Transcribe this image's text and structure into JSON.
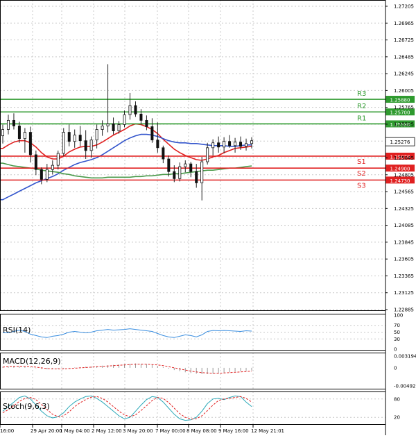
{
  "chart_data": {
    "type": "candlestick",
    "instrument_note": "",
    "x_tick_labels": [
      "16:00",
      "29 Apr 20:00",
      "1 May 04:00",
      "2 May 12:00",
      "3 May 20:00",
      "7 May 00:00",
      "8 May 08:00",
      "9 May 16:00",
      "12 May 21:01"
    ],
    "price_axis": {
      "ylim": [
        1.22885,
        1.27205
      ],
      "tick_labels": [
        "1.27205",
        "1.26965",
        "1.26725",
        "1.26485",
        "1.26245",
        "1.26005",
        "1.25765",
        "1.25525",
        "1.25285",
        "1.25045",
        "1.24805",
        "1.24565",
        "1.24325",
        "1.24085",
        "1.23845",
        "1.23605",
        "1.23365",
        "1.23125",
        "1.22885"
      ]
    },
    "levels": [
      {
        "name": "R3",
        "value": 1.2588,
        "label": "1.25880",
        "color": "#2e9a2e"
      },
      {
        "name": "R2",
        "value": 1.257,
        "label": "1.25700",
        "color": "#2e9a2e"
      },
      {
        "name": "R1",
        "value": 1.2553,
        "label": "1.25530",
        "color": "#2e9a2e"
      },
      {
        "name": "S1",
        "value": 1.2507,
        "label": "1.25070",
        "color": "#e02020"
      },
      {
        "name": "S2",
        "value": 1.249,
        "label": "1.24900",
        "color": "#e02020"
      },
      {
        "name": "S3",
        "value": 1.2473,
        "label": "1.24730",
        "color": "#e02020"
      }
    ],
    "last_price": {
      "value": 1.25276,
      "label": "1.25276"
    },
    "candles_ohlc": [
      [
        1.2536,
        1.2552,
        1.2525,
        1.2545
      ],
      [
        1.2545,
        1.2566,
        1.2538,
        1.2558
      ],
      [
        1.2558,
        1.2568,
        1.2545,
        1.255
      ],
      [
        1.255,
        1.2556,
        1.2526,
        1.2532
      ],
      [
        1.2532,
        1.2547,
        1.2512,
        1.2541
      ],
      [
        1.2541,
        1.2549,
        1.2498,
        1.2509
      ],
      [
        1.2509,
        1.2515,
        1.248,
        1.2488
      ],
      [
        1.2488,
        1.2491,
        1.2467,
        1.2474
      ],
      [
        1.2474,
        1.2496,
        1.247,
        1.2488
      ],
      [
        1.2488,
        1.2501,
        1.2481,
        1.2494
      ],
      [
        1.2494,
        1.2515,
        1.2488,
        1.2511
      ],
      [
        1.2511,
        1.2547,
        1.2507,
        1.2541
      ],
      [
        1.2541,
        1.2552,
        1.2521,
        1.2528
      ],
      [
        1.2528,
        1.2545,
        1.2519,
        1.2537
      ],
      [
        1.2537,
        1.255,
        1.2521,
        1.2529
      ],
      [
        1.2529,
        1.2544,
        1.2503,
        1.2515
      ],
      [
        1.2515,
        1.2535,
        1.2505,
        1.253
      ],
      [
        1.253,
        1.2552,
        1.2518,
        1.2545
      ],
      [
        1.2545,
        1.2558,
        1.2536,
        1.255
      ],
      [
        1.255,
        1.2638,
        1.2541,
        1.2553
      ],
      [
        1.2553,
        1.2562,
        1.2538,
        1.2543
      ],
      [
        1.2543,
        1.2557,
        1.2539,
        1.2552
      ],
      [
        1.2552,
        1.2572,
        1.2548,
        1.2566
      ],
      [
        1.2566,
        1.2597,
        1.2559,
        1.2579
      ],
      [
        1.2579,
        1.2585,
        1.2563,
        1.2567
      ],
      [
        1.2567,
        1.2574,
        1.2552,
        1.2558
      ],
      [
        1.2558,
        1.2565,
        1.2544,
        1.2549
      ],
      [
        1.2549,
        1.2561,
        1.2526,
        1.253
      ],
      [
        1.253,
        1.2555,
        1.2512,
        1.2519
      ],
      [
        1.2519,
        1.2522,
        1.2497,
        1.2503
      ],
      [
        1.2503,
        1.2508,
        1.2478,
        1.2485
      ],
      [
        1.2485,
        1.2494,
        1.247,
        1.2475
      ],
      [
        1.2475,
        1.2498,
        1.2471,
        1.2492
      ],
      [
        1.2492,
        1.2501,
        1.2484,
        1.2496
      ],
      [
        1.2496,
        1.2499,
        1.2477,
        1.2485
      ],
      [
        1.2485,
        1.2496,
        1.2462,
        1.2469
      ],
      [
        1.2469,
        1.2506,
        1.2444,
        1.2499
      ],
      [
        1.2499,
        1.2526,
        1.2495,
        1.2519
      ],
      [
        1.2519,
        1.2531,
        1.2508,
        1.2526
      ],
      [
        1.2526,
        1.2535,
        1.2512,
        1.252
      ],
      [
        1.252,
        1.2534,
        1.2511,
        1.2528
      ],
      [
        1.2528,
        1.2537,
        1.2519,
        1.2522
      ],
      [
        1.2522,
        1.2533,
        1.2512,
        1.2527
      ],
      [
        1.2527,
        1.2535,
        1.2516,
        1.2521
      ],
      [
        1.2521,
        1.2532,
        1.2515,
        1.2525
      ],
      [
        1.2525,
        1.2534,
        1.2518,
        1.2529
      ]
    ],
    "moving_averages": [
      {
        "color": "#e02020",
        "values": [
          1.2518,
          1.2523,
          1.2527,
          1.2529,
          1.2529,
          1.2526,
          1.252,
          1.2512,
          1.2506,
          1.2503,
          1.2503,
          1.2507,
          1.2513,
          1.2517,
          1.252,
          1.2521,
          1.2521,
          1.2523,
          1.2527,
          1.2532,
          1.2537,
          1.2541,
          1.2545,
          1.255,
          1.2553,
          1.2552,
          1.2549,
          1.2545,
          1.2539,
          1.2531,
          1.2524,
          1.2517,
          1.2512,
          1.2508,
          1.2505,
          1.2502,
          1.2501,
          1.2503,
          1.2506,
          1.2508,
          1.2512,
          1.2515,
          1.2518,
          1.2519,
          1.252,
          1.2521
        ]
      },
      {
        "color": "#3355cc",
        "values": [
          1.2445,
          1.2449,
          1.2453,
          1.2457,
          1.2461,
          1.2465,
          1.2469,
          1.2472,
          1.2475,
          1.2478,
          1.2482,
          1.2487,
          1.2491,
          1.2495,
          1.2498,
          1.25,
          1.2502,
          1.2505,
          1.2509,
          1.2514,
          1.2519,
          1.2524,
          1.2529,
          1.2533,
          1.2536,
          1.2538,
          1.2538,
          1.2537,
          1.2535,
          1.2532,
          1.2529,
          1.2527,
          1.2526,
          1.2526,
          1.2525,
          1.2525,
          1.2524,
          1.2523,
          1.2522,
          1.2522,
          1.2522,
          1.2521,
          1.2521,
          1.2522,
          1.2523,
          1.2523
        ]
      },
      {
        "color": "#4a9a4a",
        "values": [
          1.2497,
          1.2495,
          1.2493,
          1.2492,
          1.2491,
          1.249,
          1.2489,
          1.2487,
          1.2486,
          1.2485,
          1.2484,
          1.2482,
          1.2481,
          1.2479,
          1.2478,
          1.2477,
          1.2476,
          1.2476,
          1.2476,
          1.2477,
          1.2477,
          1.2477,
          1.2477,
          1.2477,
          1.2478,
          1.2478,
          1.2479,
          1.2479,
          1.248,
          1.2481,
          1.2481,
          1.2482,
          1.2482,
          1.2483,
          1.2484,
          1.2485,
          1.2486,
          1.2487,
          1.2487,
          1.2488,
          1.2489,
          1.249,
          1.249,
          1.2491,
          1.2492,
          1.2493
        ]
      }
    ],
    "indicators": {
      "rsi": {
        "label": "RSI(14)",
        "tick_labels": [
          "100",
          "70",
          "50",
          "30",
          "0"
        ],
        "range": [
          0,
          100
        ],
        "values": [
          48,
          48,
          52,
          56,
          52,
          44,
          40,
          36,
          34,
          38,
          40,
          44,
          50,
          52,
          50,
          48,
          50,
          54,
          56,
          58,
          56,
          57,
          58,
          60,
          58,
          56,
          54,
          52,
          46,
          40,
          36,
          34,
          38,
          42,
          40,
          36,
          42,
          52,
          55,
          54,
          55,
          54,
          53,
          52,
          54,
          53
        ]
      },
      "macd": {
        "label": "MACD(12,26,9)",
        "tick_labels": [
          "0.003194",
          "0",
          "-0.00492"
        ],
        "range": [
          -0.00492,
          0.003194
        ],
        "histogram": [
          0.0003,
          0.0004,
          0.0005,
          0.0004,
          0.0003,
          0.0001,
          -0.0001,
          -0.0003,
          -0.0004,
          -0.0004,
          -0.0003,
          -0.0002,
          -0.0001,
          0.0001,
          0.0002,
          0.0003,
          0.0004,
          0.0005,
          0.0006,
          0.0007,
          0.0008,
          0.0009,
          0.001,
          0.0011,
          0.0012,
          0.0011,
          0.001,
          0.0008,
          0.0005,
          0.0002,
          -0.0002,
          -0.0006,
          -0.0009,
          -0.0012,
          -0.0014,
          -0.0016,
          -0.0017,
          -0.0017,
          -0.0016,
          -0.0015,
          -0.0013,
          -0.0012,
          -0.001,
          -0.0009,
          -0.0008,
          -0.0007
        ],
        "signal": [
          0.0002,
          0.0003,
          0.0004,
          0.0004,
          0.0004,
          0.0003,
          0.0002,
          0.0,
          -0.0002,
          -0.0003,
          -0.0003,
          -0.0003,
          -0.0002,
          -0.0001,
          0.0,
          0.0001,
          0.0002,
          0.0003,
          0.0004,
          0.0005,
          0.0006,
          0.0007,
          0.0008,
          0.0009,
          0.001,
          0.001,
          0.001,
          0.0009,
          0.0008,
          0.0006,
          0.0003,
          0.0,
          -0.0003,
          -0.0006,
          -0.0009,
          -0.0011,
          -0.0013,
          -0.0014,
          -0.0015,
          -0.0015,
          -0.0014,
          -0.0013,
          -0.0012,
          -0.0011,
          -0.001,
          -0.0009
        ]
      },
      "stoch": {
        "label": "Stoch(9,6,3)",
        "tick_labels": [
          "80",
          "20"
        ],
        "range": [
          0,
          100
        ],
        "k": [
          40,
          55,
          70,
          85,
          90,
          80,
          60,
          40,
          25,
          18,
          22,
          35,
          55,
          70,
          80,
          88,
          90,
          82,
          70,
          55,
          40,
          25,
          15,
          20,
          40,
          60,
          78,
          88,
          85,
          70,
          50,
          30,
          15,
          10,
          12,
          20,
          40,
          65,
          80,
          82,
          78,
          85,
          90,
          88,
          70,
          55
        ],
        "d": [
          35,
          45,
          58,
          72,
          82,
          85,
          78,
          62,
          45,
          30,
          22,
          25,
          38,
          55,
          68,
          78,
          86,
          88,
          82,
          70,
          55,
          40,
          28,
          22,
          28,
          42,
          58,
          75,
          85,
          82,
          68,
          50,
          32,
          20,
          14,
          15,
          25,
          42,
          60,
          75,
          80,
          82,
          85,
          88,
          82,
          70
        ]
      }
    }
  }
}
